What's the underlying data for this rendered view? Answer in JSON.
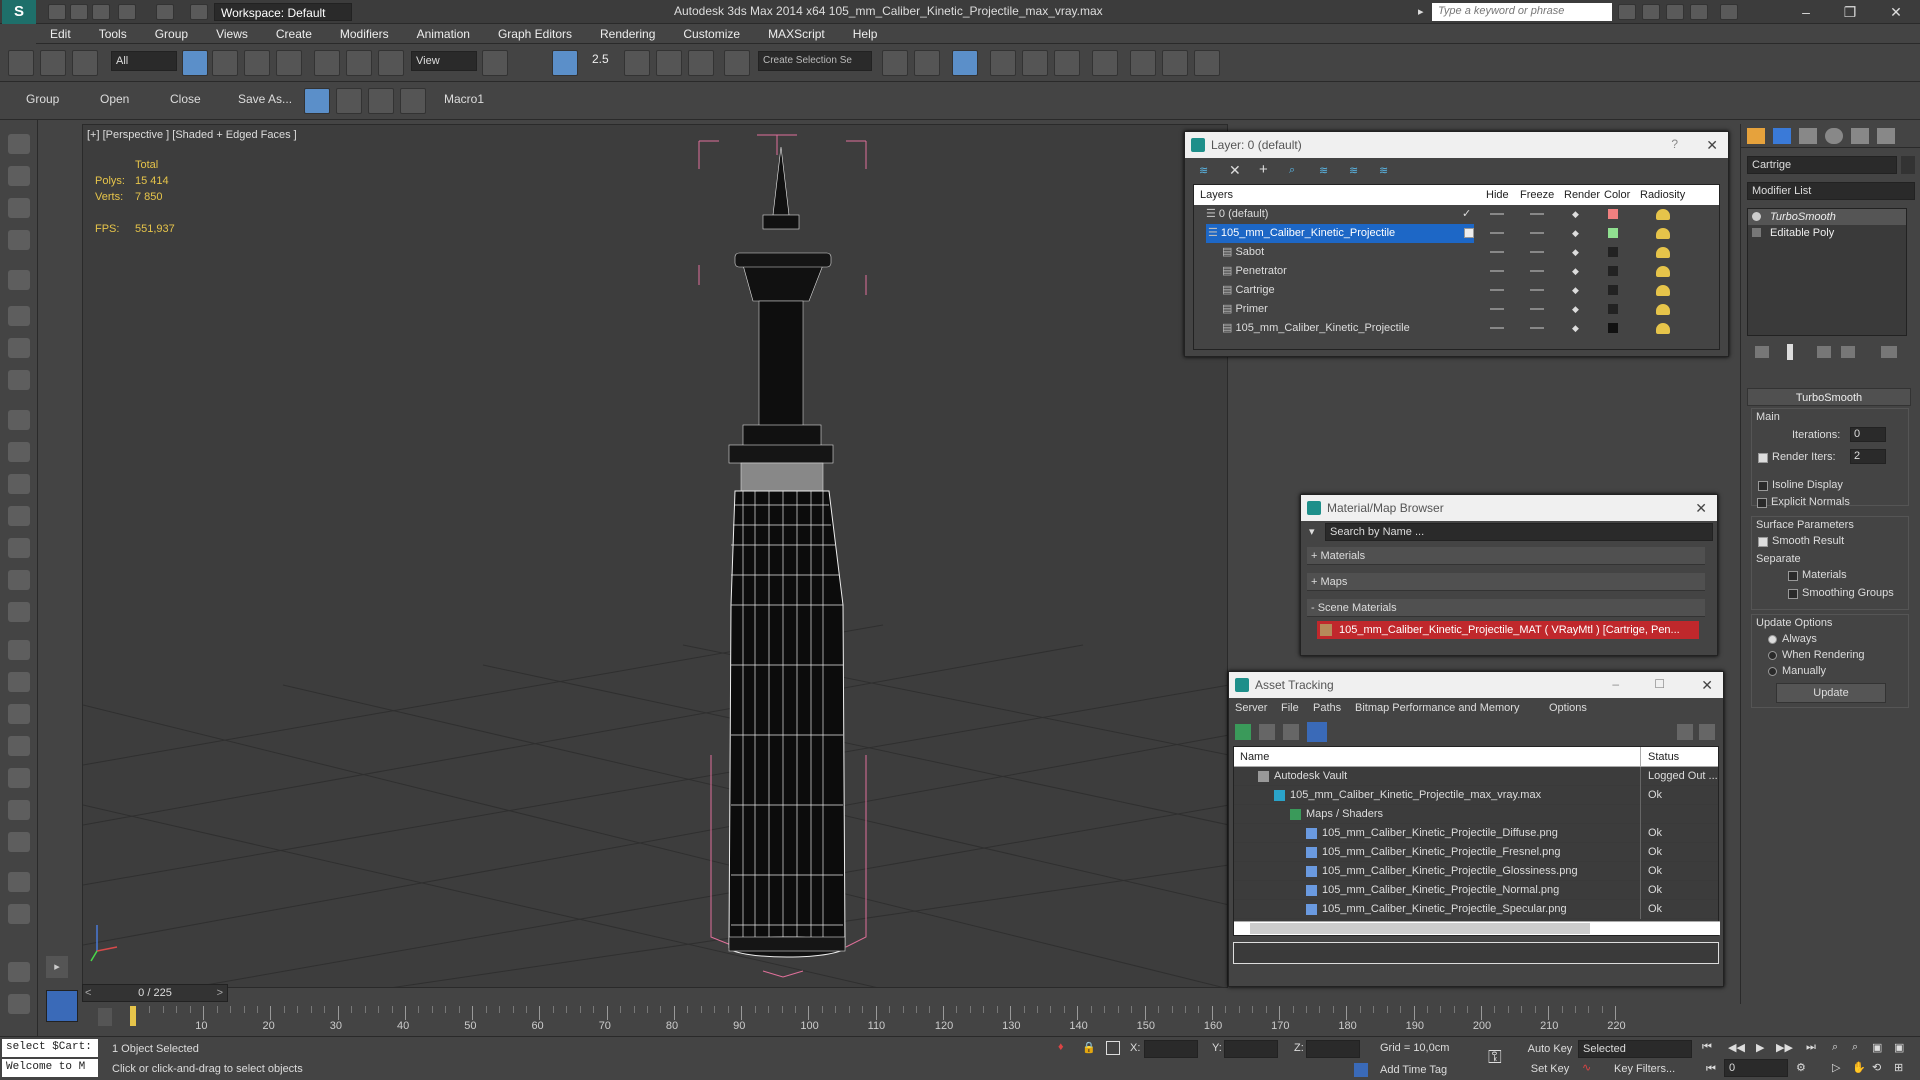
{
  "titlebar": {
    "workspace": "Workspace: Default",
    "title": "Autodesk 3ds Max  2014 x64      105_mm_Caliber_Kinetic_Projectile_max_vray.max",
    "search_placeholder": "Type a keyword or phrase"
  },
  "menu": [
    "Edit",
    "Tools",
    "Group",
    "Views",
    "Create",
    "Modifiers",
    "Animation",
    "Graph Editors",
    "Rendering",
    "Customize",
    "MAXScript",
    "Help"
  ],
  "toolbar": {
    "selection_filter": "All",
    "ref_coord": "View",
    "snap_label": "2.5",
    "named_selection": "Create Selection Se"
  },
  "ribbon": [
    "Group",
    "Open",
    "Close",
    "Save As...",
    "Macro1"
  ],
  "viewport": {
    "label": "[+] [Perspective ] [Shaded + Edged Faces ]",
    "stats": {
      "total": "Total",
      "polys_label": "Polys:",
      "polys": "15 414",
      "verts_label": "Verts:",
      "verts": "7 850",
      "fps_label": "FPS:",
      "fps": "551,937"
    }
  },
  "layer_dialog": {
    "title": "Layer: 0 (default)",
    "columns": [
      "Layers",
      "Hide",
      "Freeze",
      "Render",
      "Color",
      "Radiosity"
    ],
    "rows": [
      {
        "name": "0 (default)",
        "color": "#f08080",
        "indent": 0,
        "selected": false
      },
      {
        "name": "105_mm_Caliber_Kinetic_Projectile",
        "color": "#90e090",
        "indent": 0,
        "selected": true
      },
      {
        "name": "Sabot",
        "color": "#222222",
        "indent": 1,
        "selected": false
      },
      {
        "name": "Penetrator",
        "color": "#222222",
        "indent": 1,
        "selected": false
      },
      {
        "name": "Cartrige",
        "color": "#222222",
        "indent": 1,
        "selected": false
      },
      {
        "name": "Primer",
        "color": "#222222",
        "indent": 1,
        "selected": false
      },
      {
        "name": "105_mm_Caliber_Kinetic_Projectile",
        "color": "#111111",
        "indent": 1,
        "selected": false
      }
    ]
  },
  "material_browser": {
    "title": "Material/Map Browser",
    "search_placeholder": "Search by Name ...",
    "sections": [
      "+ Materials",
      "+ Maps",
      "- Scene Materials"
    ],
    "scene_material": "105_mm_Caliber_Kinetic_Projectile_MAT  ( VRayMtl )  [Cartrige, Pen..."
  },
  "asset_tracking": {
    "title": "Asset Tracking",
    "menu": [
      "Server",
      "File",
      "Paths",
      "Bitmap Performance and Memory",
      "Options"
    ],
    "columns": [
      "Name",
      "Status"
    ],
    "rows": [
      {
        "name": "Autodesk Vault",
        "status": "Logged Out ...",
        "indent": 1
      },
      {
        "name": "105_mm_Caliber_Kinetic_Projectile_max_vray.max",
        "status": "Ok",
        "indent": 2
      },
      {
        "name": "Maps / Shaders",
        "status": "",
        "indent": 3
      },
      {
        "name": "105_mm_Caliber_Kinetic_Projectile_Diffuse.png",
        "status": "Ok",
        "indent": 4
      },
      {
        "name": "105_mm_Caliber_Kinetic_Projectile_Fresnel.png",
        "status": "Ok",
        "indent": 4
      },
      {
        "name": "105_mm_Caliber_Kinetic_Projectile_Glossiness.png",
        "status": "Ok",
        "indent": 4
      },
      {
        "name": "105_mm_Caliber_Kinetic_Projectile_Normal.png",
        "status": "Ok",
        "indent": 4
      },
      {
        "name": "105_mm_Caliber_Kinetic_Projectile_Specular.png",
        "status": "Ok",
        "indent": 4
      }
    ]
  },
  "command_panel": {
    "object_name": "Cartrige",
    "modifier_list": "Modifier List",
    "stack": [
      "TurboSmooth",
      "Editable Poly"
    ],
    "rollout_title": "TurboSmooth",
    "main_label": "Main",
    "iterations_label": "Iterations:",
    "iterations": "0",
    "render_iters_label": "Render Iters:",
    "render_iters": "2",
    "isoline": "Isoline Display",
    "explicit_normals": "Explicit Normals",
    "surface_params": "Surface Parameters",
    "smooth_result": "Smooth Result",
    "separate": "Separate",
    "materials": "Materials",
    "smoothing_groups": "Smoothing Groups",
    "update_options": "Update Options",
    "always": "Always",
    "when_rendering": "When Rendering",
    "manually": "Manually",
    "update_button": "Update"
  },
  "timeline": {
    "frame": "0 / 225",
    "ticks": [
      "10",
      "20",
      "30",
      "40",
      "50",
      "60",
      "70",
      "80",
      "90",
      "100",
      "110",
      "120",
      "130",
      "140",
      "150",
      "160",
      "170",
      "180",
      "190",
      "200",
      "210",
      "220"
    ]
  },
  "status": {
    "maxscript_line1": "select $Cart:",
    "maxscript_line2": "Welcome to M",
    "selected": "1 Object Selected",
    "prompt": "Click or click-and-drag to select objects",
    "x_label": "X:",
    "y_label": "Y:",
    "z_label": "Z:",
    "grid": "Grid = 10,0cm",
    "add_time_tag": "Add Time Tag",
    "auto_key": "Auto Key",
    "set_key": "Set Key",
    "selected_combo": "Selected",
    "key_filters": "Key Filters...",
    "frame_field": "0"
  }
}
